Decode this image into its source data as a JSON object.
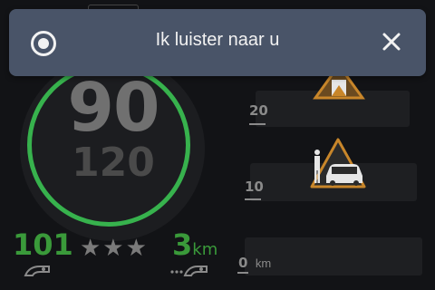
{
  "notification": {
    "message": "Ik luister naar u",
    "status_icon": "record-icon",
    "close_icon": "close-icon"
  },
  "speedometer": {
    "current_speed": "90",
    "speed_limit": "120",
    "ring_color": "#37b24d"
  },
  "stats": {
    "left_value": "101",
    "rating_stars": 3,
    "right_value": "3",
    "right_unit": "km",
    "accent_color": "#3a9a3a"
  },
  "warnings": [
    {
      "distance": "20",
      "icon": "warning-triangle-icon"
    },
    {
      "distance": "10",
      "icon": "warning-triangle-person-car-icon"
    },
    {
      "distance": "0",
      "unit": "km"
    }
  ]
}
